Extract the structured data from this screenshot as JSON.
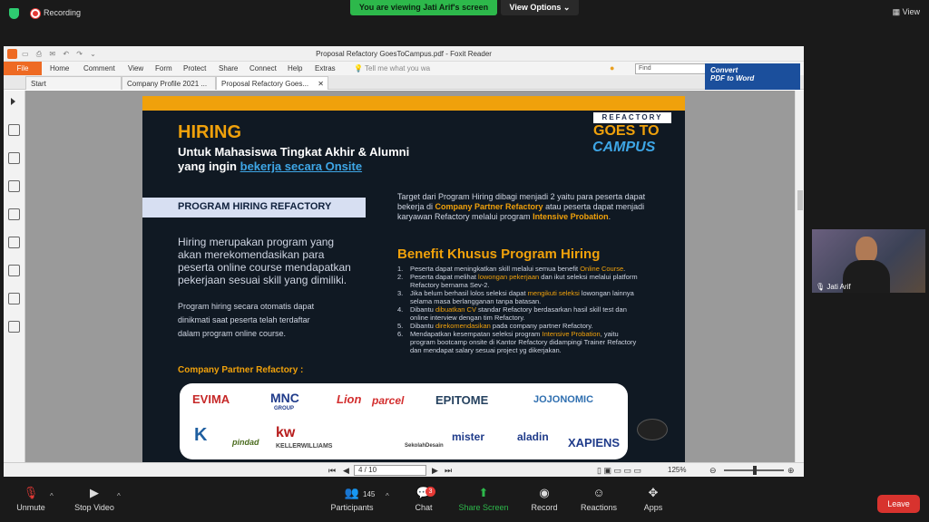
{
  "zoom": {
    "recording_label": "Recording",
    "viewing_banner": "You are viewing Jati Arif's screen",
    "view_options": "View Options",
    "view_button": "View",
    "participants_count": "145",
    "chat_badge": "3",
    "participant_name": "Jati Arif",
    "toolbar": {
      "unmute": "Unmute",
      "stop_video": "Stop Video",
      "participants": "Participants",
      "chat": "Chat",
      "share_screen": "Share Screen",
      "record": "Record",
      "reactions": "Reactions",
      "apps": "Apps",
      "leave": "Leave"
    }
  },
  "foxit": {
    "window_title": "Proposal Refactory GoesToCampus.pdf - Foxit Reader",
    "menu": {
      "file": "File",
      "home": "Home",
      "comment": "Comment",
      "view": "View",
      "form": "Form",
      "protect": "Protect",
      "share": "Share",
      "connect": "Connect",
      "help": "Help",
      "extras": "Extras",
      "tell_me": "Tell me what you wa",
      "find_placeholder": "Find"
    },
    "tabs": [
      {
        "label": "Start"
      },
      {
        "label": "Company Profile 2021 ..."
      },
      {
        "label": "Proposal Refactory Goes..."
      }
    ],
    "convert_line1": "Convert",
    "convert_line2": "PDF to Word",
    "status": {
      "page_indicator": "4 / 10",
      "zoom": "125%"
    }
  },
  "pdf": {
    "hiring": "HIRING",
    "subtitle1": "Untuk Mahasiswa Tingkat Akhir & Alumni",
    "subtitle2_prefix": "yang ingin ",
    "subtitle2_link": "bekerja secara Onsite",
    "badge_refactory": "REFACTORY",
    "badge_goes": "GOES TO",
    "badge_campus": "CAMPUS",
    "program_title": "PROGRAM HIRING REFACTORY",
    "desc": "Hiring merupakan program yang akan merekomendasikan para peserta online course mendapatkan pekerjaan sesuai skill yang dimiliki.",
    "small1": "Program hiring secara otomatis dapat",
    "small2": "dinikmati saat peserta telah terdaftar",
    "small3": "dalam program online course.",
    "partner_title": "Company Partner Refactory :",
    "target_1": "Target dari Program Hiring dibagi menjadi 2 yaitu para peserta dapat bekerja di ",
    "target_hl1": "Company Partner Refactory",
    "target_2": " atau peserta dapat menjadi karyawan Refactory melalui program ",
    "target_hl2": "Intensive Probation",
    "target_3": ".",
    "benefit_title": "Benefit Khusus Program Hiring",
    "benefits": [
      {
        "n": "1.",
        "a": "Peserta dapat meningkatkan skill melalui semua benefit ",
        "hl": "Online Course",
        "b": "."
      },
      {
        "n": "2.",
        "a": "Peserta dapat melihat ",
        "hl": "lowongan pekerjaan",
        "b": " dan ikut seleksi melalui platform Refactory bernama Sev-2."
      },
      {
        "n": "3.",
        "a": "Jika belum berhasil lolos seleksi dapat ",
        "hl": "mengikuti seleksi",
        "b": " lowongan lainnya selama masa berlangganan tanpa batasan."
      },
      {
        "n": "4.",
        "a": "Dibantu ",
        "hl": "dibuatkan CV",
        "b": " standar Refactory berdasarkan hasil skill test dan online interview dengan tim Refactory."
      },
      {
        "n": "5.",
        "a": "Dibantu ",
        "hl": "direkomendasikan",
        "b": " pada company partner Refactory."
      },
      {
        "n": "6.",
        "a": "Mendapatkan kesempatan seleksi program ",
        "hl": "Intensive Probation",
        "b": ", yaitu program bootcamp onsite di Kantor Refactory didampingi Trainer Refactory dan mendapat salary sesuai project yg dikerjakan."
      }
    ],
    "logos": [
      "EVIMA",
      "MNC",
      "GROUP",
      "Lion",
      "parcel",
      "EPITOME",
      "JOJONOMIC",
      "K",
      "pindad",
      "KELLERWILLIAMS",
      "SekolahDesain",
      "mister",
      "aladin",
      "XAPIENS"
    ]
  }
}
